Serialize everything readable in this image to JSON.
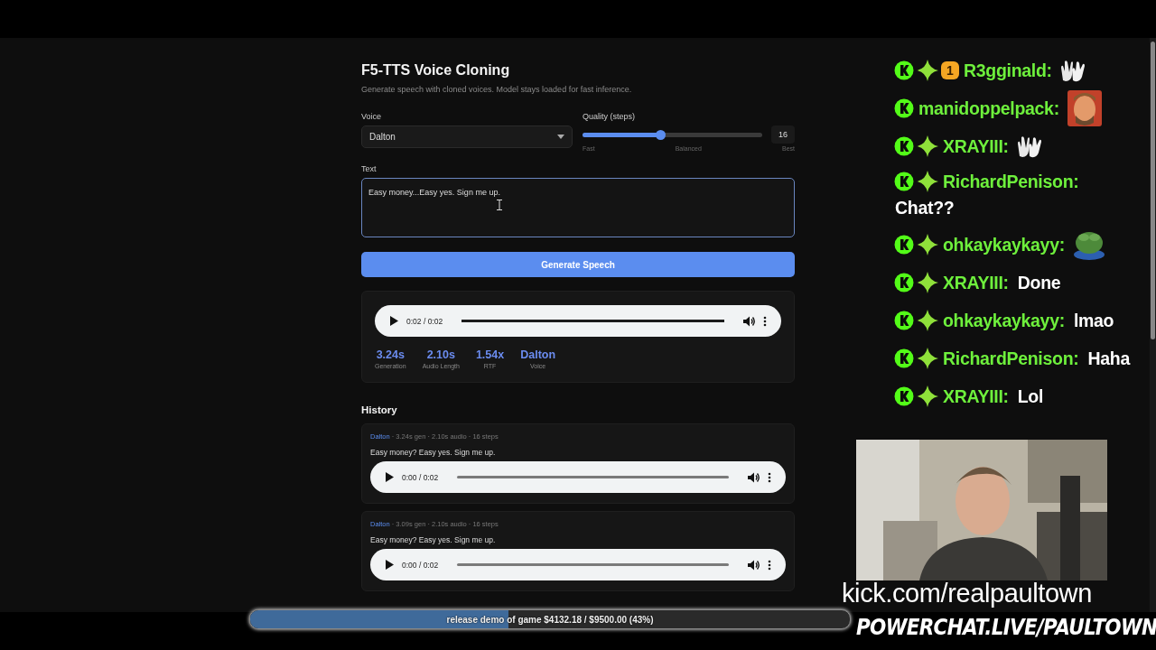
{
  "app": {
    "title": "F5-TTS Voice Cloning",
    "subtitle": "Generate speech with cloned voices. Model stays loaded for fast inference.",
    "voice": {
      "label": "Voice",
      "value": "Dalton"
    },
    "quality": {
      "label": "Quality (steps)",
      "level": 0.43,
      "value": "16",
      "marks": [
        "Fast",
        "Balanced",
        "Best"
      ]
    },
    "text": {
      "label": "Text",
      "value": "Easy money...Easy yes. Sign me up."
    },
    "generate_button": "Generate Speech",
    "result": {
      "player": {
        "time": "0:02 / 0:02",
        "level": 1
      },
      "stats": [
        {
          "value": "3.24s",
          "label": "Generation"
        },
        {
          "value": "2.10s",
          "label": "Audio Length"
        },
        {
          "value": "1.54x",
          "label": "RTF"
        },
        {
          "value": "Dalton",
          "label": "Voice"
        }
      ]
    },
    "history": {
      "title": "History",
      "items": [
        {
          "voice": "Dalton",
          "meta": " · 3.24s gen · 2.10s audio · 16 steps",
          "text": "Easy money? Easy yes. Sign me up.",
          "player": {
            "time": "0:00 / 0:02",
            "level": 0
          }
        },
        {
          "voice": "Dalton",
          "meta": " · 3.09s gen · 2.10s audio · 16 steps",
          "text": "Easy money? Easy yes. Sign me up.",
          "player": {
            "time": "0:00 / 0:02",
            "level": 0
          }
        }
      ]
    }
  },
  "chat": [
    {
      "badges": [
        {
          "kind": "platform"
        },
        {
          "kind": "subscriber"
        },
        {
          "kind": "rank",
          "text": "1"
        }
      ],
      "user": "R3gginald:",
      "emote": {
        "kind": "clap"
      }
    },
    {
      "badges": [
        {
          "kind": "platform"
        }
      ],
      "user": "manidoppelpack:",
      "emote": {
        "kind": "face"
      }
    },
    {
      "badges": [
        {
          "kind": "platform"
        },
        {
          "kind": "subscriber"
        }
      ],
      "user": "XRAYIII:",
      "emote": {
        "kind": "clap"
      }
    },
    {
      "badges": [
        {
          "kind": "platform"
        },
        {
          "kind": "subscriber"
        }
      ],
      "user": "RichardPenison:",
      "message": "Chat??",
      "wrap": true
    },
    {
      "badges": [
        {
          "kind": "platform"
        },
        {
          "kind": "subscriber"
        }
      ],
      "user": "ohkaykaykayy:",
      "emote": {
        "kind": "frog"
      }
    },
    {
      "badges": [
        {
          "kind": "platform"
        },
        {
          "kind": "subscriber"
        }
      ],
      "user": "XRAYIII:",
      "message": "Done"
    },
    {
      "badges": [
        {
          "kind": "platform"
        },
        {
          "kind": "subscriber"
        }
      ],
      "user": "ohkaykaykayy:",
      "message": "lmao"
    },
    {
      "badges": [
        {
          "kind": "platform"
        },
        {
          "kind": "subscriber"
        }
      ],
      "user": "RichardPenison:",
      "message": "Haha"
    },
    {
      "badges": [
        {
          "kind": "platform"
        },
        {
          "kind": "subscriber"
        }
      ],
      "user": "XRAYIII:",
      "message": "Lol"
    }
  ],
  "channel_url": "kick.com/realpaultown",
  "goal": {
    "text": "release demo of game $4132.18 / $9500.00 (43%)",
    "level": 0.43
  },
  "powerchat": "POWERCHAT.LIVE/PAULTOWN"
}
